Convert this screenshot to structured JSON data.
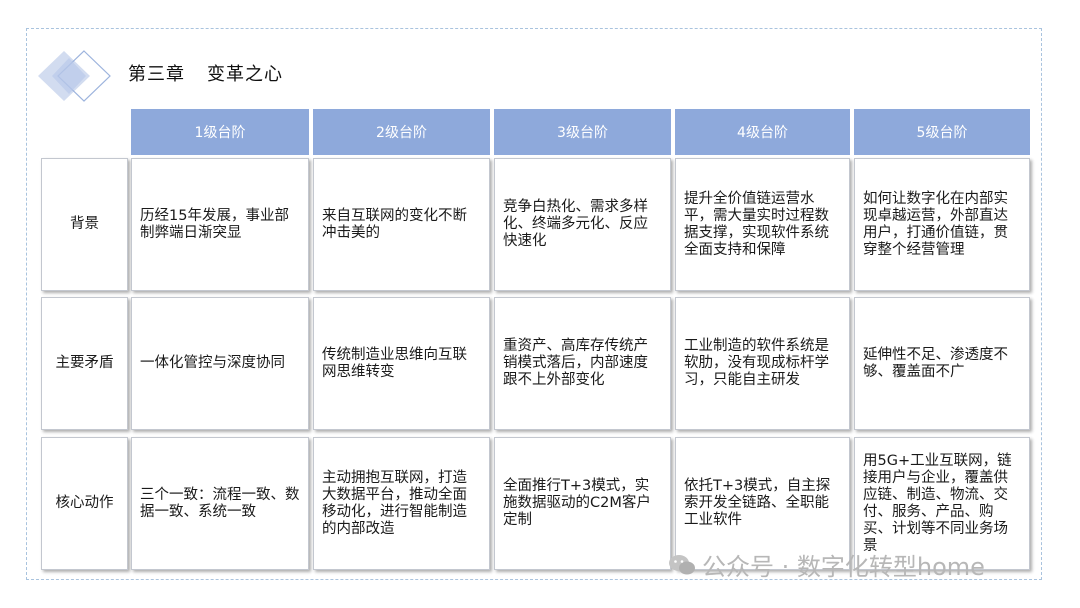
{
  "title": {
    "chapter": "第三章",
    "name": "变革之心"
  },
  "columns": [
    "1级台阶",
    "2级台阶",
    "3级台阶",
    "4级台阶",
    "5级台阶"
  ],
  "rows": [
    {
      "label": "背景",
      "cells": [
        "历经15年发展，事业部制弊端日渐突显",
        "来自互联网的变化不断冲击美的",
        "竞争白热化、需求多样化、终端多元化、反应快速化",
        "提升全价值链运营水平，需大量实时过程数据支撑，实现软件系统全面支持和保障",
        "如何让数字化在内部实现卓越运营，外部直达用户，打通价值链，贯穿整个经营管理"
      ]
    },
    {
      "label": "主要矛盾",
      "cells": [
        "一体化管控与深度协同",
        "传统制造业思维向互联网思维转变",
        "重资产、高库存传统产销模式落后，内部速度跟不上外部变化",
        "工业制造的软件系统是软肋，没有现成标杆学习，只能自主研发",
        "延伸性不足、渗透度不够、覆盖面不广"
      ]
    },
    {
      "label": "核心动作",
      "cells": [
        "三个一致：流程一致、数据一致、系统一致",
        "主动拥抱互联网，打造大数据平台，推动全面移动化，进行智能制造的内部改造",
        "全面推行T+3模式，实施数据驱动的C2M客户定制",
        "依托T+3模式，自主探索开发全链路、全职能工业软件",
        "用5G+工业互联网，链接用户与企业，覆盖供应链、制造、物流、交付、服务、产品、购买、计划等不同业务场景"
      ]
    }
  ],
  "watermark": "公众号 · 数字化转型home",
  "colors": {
    "header": "#8ea9db",
    "frame": "#a9c3de"
  }
}
